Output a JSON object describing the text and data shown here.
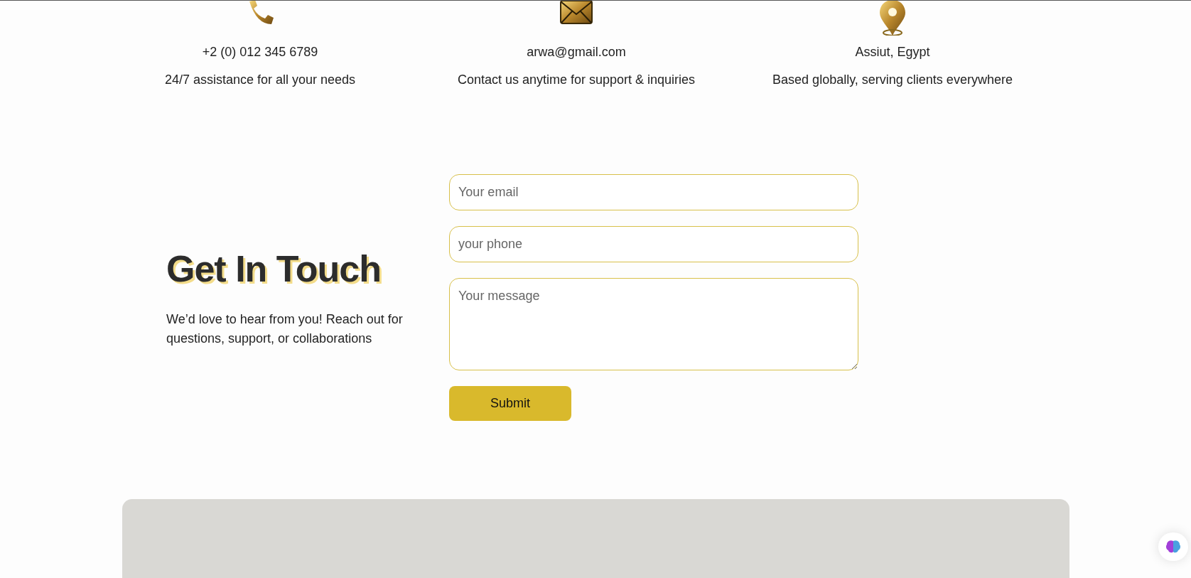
{
  "contacts": [
    {
      "kind": "phone",
      "value": "+2 (0) 012 345 6789",
      "description": "24/7 assistance for all your needs"
    },
    {
      "kind": "email",
      "value": "arwa@gmail.com",
      "description": "Contact us anytime for support & inquiries"
    },
    {
      "kind": "location",
      "value": "Assiut, Egypt",
      "description": "Based globally, serving clients everywhere"
    }
  ],
  "intro": {
    "title": "Get In Touch",
    "text": "We’d love to hear from you! Reach out for questions, support, or collaborations"
  },
  "form": {
    "fields": [
      {
        "kind": "input",
        "placeholder": "Your email"
      },
      {
        "kind": "input",
        "placeholder": "your phone"
      },
      {
        "kind": "textarea",
        "placeholder": "Your message"
      }
    ],
    "submit": "Submit"
  }
}
